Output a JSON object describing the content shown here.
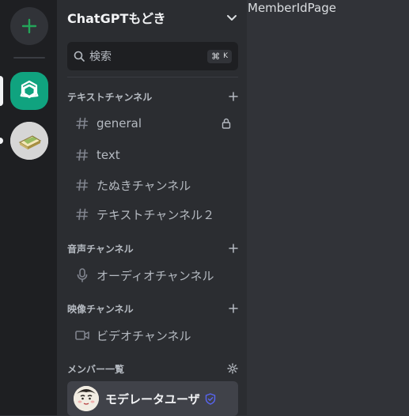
{
  "server_rail": {
    "add_button_icon": "plus-icon",
    "servers": [
      {
        "icon": "chatgpt-logo-icon",
        "active": true,
        "color": "#10a37f"
      },
      {
        "icon": "bread-avatar-icon",
        "active": false,
        "unread": true
      }
    ]
  },
  "sidebar": {
    "server_name": "ChatGPTもどき",
    "search": {
      "placeholder": "検索",
      "shortcut_symbol": "⌘",
      "shortcut_key": "K"
    },
    "categories": [
      {
        "label": "テキストチャンネル",
        "channels": [
          {
            "name": "general",
            "icon": "hash-icon",
            "locked": true
          },
          {
            "name": "text",
            "icon": "hash-icon"
          },
          {
            "name": "たぬきチャンネル",
            "icon": "hash-icon"
          },
          {
            "name": "テキストチャンネル２",
            "icon": "hash-icon"
          }
        ]
      },
      {
        "label": "音声チャンネル",
        "channels": [
          {
            "name": "オーディオチャンネル",
            "icon": "mic-icon"
          }
        ]
      },
      {
        "label": "映像チャンネル",
        "channels": [
          {
            "name": "ビデオチャンネル",
            "icon": "video-icon"
          }
        ]
      }
    ],
    "members": {
      "label": "メンバー一覧",
      "items": [
        {
          "name": "モデレータユーザ",
          "badge": "shield-check-icon",
          "badge_color": "#5865f2"
        }
      ]
    }
  },
  "main": {
    "title": "MemberIdPage"
  },
  "colors": {
    "accent": "#10a37f",
    "rail_bg": "#1e1f22",
    "sidebar_bg": "#2b2d31",
    "main_bg": "#313338"
  }
}
